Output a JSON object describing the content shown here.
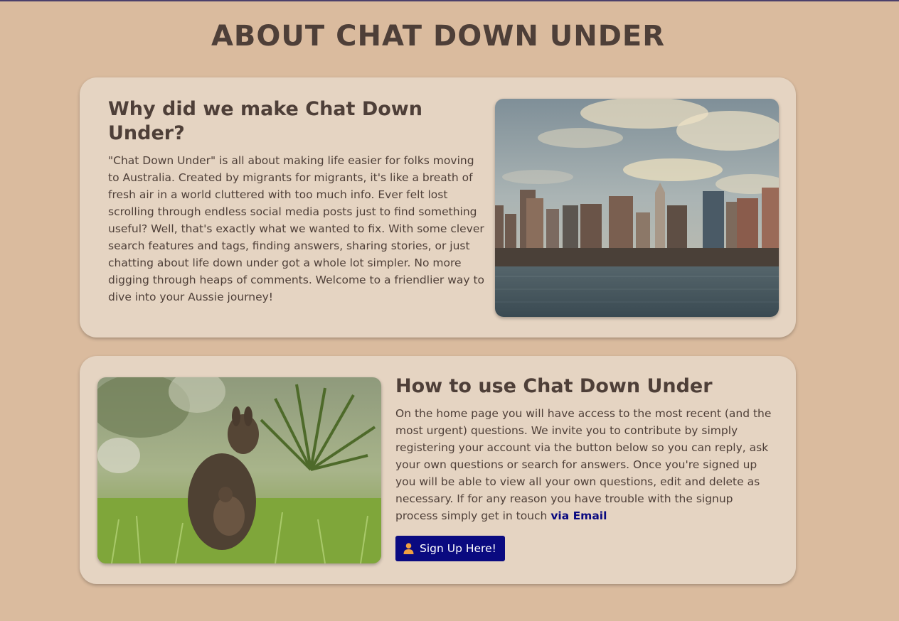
{
  "page": {
    "title": "ABOUT CHAT DOWN UNDER"
  },
  "about": {
    "heading": "Why did we make Chat Down Under?",
    "body": "\"Chat Down Under\" is all about making life easier for folks moving to Australia. Created by migrants for migrants, it's like a breath of fresh air in a world cluttered with too much info. Ever felt lost scrolling through endless social media posts just to find something useful? Well, that's exactly what we wanted to fix. With some clever search features and tags, finding answers, sharing stories, or just chatting about life down under got a whole lot simpler. No more digging through heaps of comments. Welcome to a friendlier way to dive into your Aussie journey!",
    "image_icon": "city-skyline-photo"
  },
  "howto": {
    "heading": "How to use Chat Down Under",
    "body": "On the home page you will have access to the most recent (and the most urgent) questions. We invite you to contribute by simply registering your account via the button below so you can reply, ask your own questions or search for answers. Once you're signed up you will be able to view all your own questions, edit and delete as necessary. If for any reason you have trouble with the signup process simply get in touch ",
    "email_link": "via Email",
    "signup_button": "Sign Up Here!",
    "signup_icon": "user-icon",
    "image_icon": "wallaby-photo"
  },
  "colors": {
    "background": "#dabb9e",
    "card": "#e5d4c2",
    "text": "#4e3f38",
    "accent": "#0a0a80",
    "icon_orange": "#f0a040"
  }
}
